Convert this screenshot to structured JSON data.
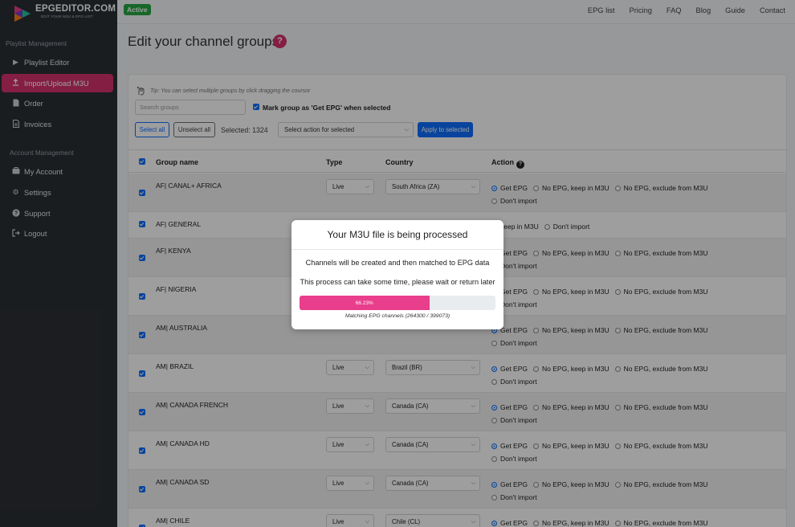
{
  "brand": {
    "name": "EPGEDITOR.COM",
    "tagline": "EDIT YOUR M3U & EPG LIST"
  },
  "sidebar": {
    "sections": [
      {
        "title": "Playlist Management"
      },
      {
        "title": "Account Management"
      }
    ],
    "items": [
      {
        "label": "Playlist Editor",
        "icon": "play-icon"
      },
      {
        "label": "Import/Upload M3U",
        "icon": "upload-icon",
        "active": true
      },
      {
        "label": "Order",
        "icon": "document-icon"
      },
      {
        "label": "Invoices",
        "icon": "invoice-icon"
      },
      {
        "label": "My Account",
        "icon": "briefcase-icon"
      },
      {
        "label": "Settings",
        "icon": "gear-icon"
      },
      {
        "label": "Support",
        "icon": "question-icon"
      },
      {
        "label": "Logout",
        "icon": "logout-icon"
      }
    ]
  },
  "topbar": {
    "status": "Active",
    "nav": [
      "EPG list",
      "Pricing",
      "FAQ",
      "Blog",
      "Guide",
      "Contact"
    ]
  },
  "page": {
    "title": "Edit your channel groups",
    "help": "?"
  },
  "toolbar": {
    "tip": "Tip: You can select multiple groups by click dragging the coursor",
    "search_placeholder": "Search groups",
    "mark_label": "Mark group as 'Get EPG' when selected",
    "select_all": "Select all",
    "unselect_all": "Unselect all",
    "selected_text": "Selected: 1324",
    "action_placeholder": "Select action for selected",
    "apply": "Apply to selected"
  },
  "table": {
    "headers": {
      "group": "Group name",
      "type": "Type",
      "country": "Country",
      "action": "Action"
    },
    "options": {
      "get_epg": "Get EPG",
      "no_epg_keep": "No EPG, keep in M3U",
      "no_epg_exclude": "No EPG, exclude from M3U",
      "dont_import": "Don't import",
      "keep_in_m3u": "keep in M3U"
    },
    "rows": [
      {
        "name": "AF| CANAL+ AFRICA",
        "type": "Live",
        "country": "South Africa (ZA)"
      },
      {
        "name": "AF| GENERAL",
        "type": "",
        "country": ""
      },
      {
        "name": "AF| KENYA",
        "type": "",
        "country": ""
      },
      {
        "name": "AF| NIGERIA",
        "type": "",
        "country": ""
      },
      {
        "name": "AM| AUSTRALIA",
        "type": "",
        "country": ""
      },
      {
        "name": "AM| BRAZIL",
        "type": "Live",
        "country": "Brazil (BR)"
      },
      {
        "name": "AM| CANADA FRENCH",
        "type": "Live",
        "country": "Canada (CA)"
      },
      {
        "name": "AM| CANADA HD",
        "type": "Live",
        "country": "Canada (CA)"
      },
      {
        "name": "AM| CANADA SD",
        "type": "Live",
        "country": "Canada (CA)"
      },
      {
        "name": "AM| CHILE",
        "type": "Live",
        "country": "Chile (CL)"
      }
    ]
  },
  "modal": {
    "title": "Your M3U file is being processed",
    "line1": "Channels will be created and then matched to EPG data",
    "line2": "This process can take some time, please wait or return later",
    "progress_label": "66.23%",
    "progress_value": 66.23,
    "caption": "Matching EPG channels (264300 / 399073)"
  },
  "colors": {
    "accent": "#d6336c",
    "primary": "#0d6efd",
    "success": "#28a745",
    "sidebar": "#2b2f35",
    "progress": "#e83e8c"
  }
}
